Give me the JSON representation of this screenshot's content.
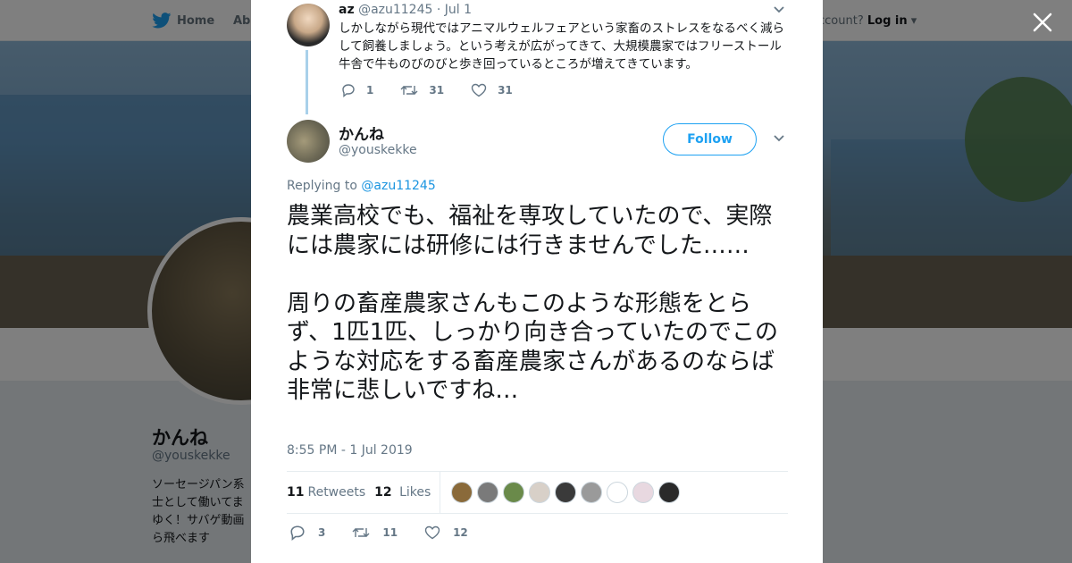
{
  "nav": {
    "home_label": "Home",
    "about_label": "Abo",
    "login_prefix": "ccount?",
    "login_label": "Log in"
  },
  "profile": {
    "name": "かんね",
    "handle": "@youskekke",
    "bio": [
      "ソーセージパン系",
      "士として働いてま",
      "ゆく！サバゲ動画",
      "ら飛べます"
    ]
  },
  "parent_tweet": {
    "name": "az",
    "handle": "@azu11245",
    "date": "· Jul 1",
    "text": "しかしながら現代ではアニマルウェルフェアという家畜のストレスをなるべく減らして飼養しましょう。という考えが広がってきて、大規模農家ではフリーストール牛舎で牛ものびのびと歩き回っているところが増えてきています。",
    "replies": "1",
    "retweets": "31",
    "likes": "31"
  },
  "tweet": {
    "name": "かんね",
    "handle": "@youskekke",
    "follow_label": "Follow",
    "replying_prefix": "Replying to",
    "replying_to": "@azu11245",
    "text": "農業高校でも、福祉を専攻していたので、実際には農家には研修には行きませんでした……\n\n周りの畜産農家さんもこのような形態をとらず、1匹1匹、しっかり向き合っていたのでこのような対応をする畜産農家さんがあるのならば非常に悲しいですね…",
    "timestamp": "8:55 PM - 1 Jul 2019",
    "retweet_count": "11",
    "retweet_label": "Retweets",
    "like_count": "12",
    "like_label": "Likes",
    "replies": "3",
    "retweets": "11",
    "likes": "12"
  },
  "likers": [
    "#8a6a3a",
    "#7a7a7a",
    "#6a8a4a",
    "#d8d0c8",
    "#3a3a3a",
    "#9a9a9a",
    "#ffffff",
    "#e8d8e0",
    "#2a2a2a"
  ],
  "colors": {
    "accent": "#1da1f2",
    "text": "#14171a",
    "muted": "#657786"
  }
}
